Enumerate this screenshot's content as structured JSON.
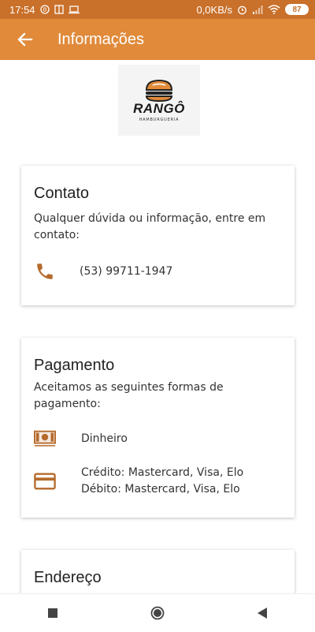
{
  "status_bar": {
    "time": "17:54",
    "network_speed": "0,0KB/s",
    "battery": "87"
  },
  "app_bar": {
    "title": "Informações"
  },
  "logo": {
    "name": "RANGÔ",
    "subtitle": "HAMBURGUERIA"
  },
  "contact": {
    "title": "Contato",
    "description": "Qualquer dúvida ou informação, entre em contato:",
    "phone": "(53) 99711-1947",
    "icon": "phone-icon"
  },
  "payment": {
    "title": "Pagamento",
    "description": "Aceitamos as seguintes formas de pagamento:",
    "cash_label": "Dinheiro",
    "credit_label": "Crédito: Mastercard, Visa, Elo",
    "debit_label": "Débito: Mastercard, Visa, Elo"
  },
  "address": {
    "title": "Endereço"
  },
  "colors": {
    "status_bar": "#c9702a",
    "app_bar": "#e08a3a",
    "icon_accent": "#b56a2c"
  }
}
